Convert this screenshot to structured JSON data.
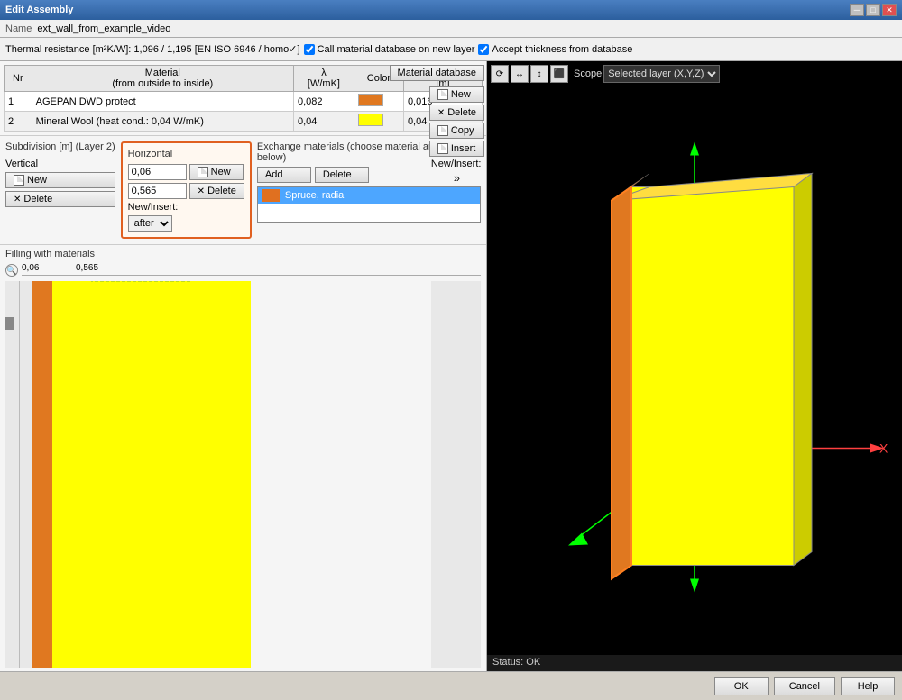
{
  "window": {
    "title": "Edit Assembly",
    "min_label": "─",
    "max_label": "□",
    "close_label": "✕"
  },
  "name_bar": {
    "label": "Name",
    "value": "ext_wall_from_example_video"
  },
  "toolbar": {
    "thermal_resistance": "Thermal resistance [m²K/W]: 1,096 / 1,195 [EN ISO 6946 / homo",
    "checkbox1_label": "Call material database on new layer",
    "checkbox2_label": "Accept thickness from database",
    "checkbox1_checked": true,
    "checkbox2_checked": true
  },
  "materials_table": {
    "headers": [
      "Nr",
      "Material\n(from outside to inside)",
      "λ\n[W/mK]",
      "Color",
      "Thickness\n[m]"
    ],
    "rows": [
      {
        "nr": "1",
        "material": "AGEPAN DWD protect",
        "lambda": "0,082",
        "color": "#e07820",
        "thickness": "0,016"
      },
      {
        "nr": "2",
        "material": "Mineral Wool (heat cond.: 0,04 W/mK)",
        "lambda": "0,04",
        "color": "#ffff00",
        "thickness": "0,04"
      }
    ]
  },
  "action_buttons": {
    "new": "New",
    "delete": "Delete",
    "copy": "Copy",
    "insert": "Insert",
    "new_insert": "New/Insert:",
    "arrow": "»"
  },
  "material_database_btn": "Material database",
  "subdivision": {
    "title": "Subdivision [m] (Layer 2)",
    "vertical_label": "Vertical",
    "vertical_new": "New",
    "vertical_delete": "Delete",
    "horizontal_label": "Horizontal",
    "horiz_value1": "0,06",
    "horiz_value2": "0,565",
    "horiz_new": "New",
    "horiz_delete": "Delete",
    "horiz_new_insert": "New/Insert:",
    "horiz_after": "after"
  },
  "exchange": {
    "title": "Exchange materials (choose material and fill in below)",
    "add_btn": "Add",
    "delete_btn": "Delete",
    "items": [
      {
        "name": "Spruce, radial",
        "color": "#e07820"
      }
    ]
  },
  "filling": {
    "title": "Filling with materials",
    "scale_values": [
      "0,06",
      "0,565"
    ],
    "magnify_icon": "🔍"
  },
  "viewer": {
    "toolbar_icons": [
      "⟳",
      "↔",
      "↕",
      "⬛"
    ],
    "scope_label": "Scope",
    "scope_value": "Selected layer (X,Y,Z)",
    "status": "Status: OK"
  },
  "bottom_buttons": {
    "ok": "OK",
    "cancel": "Cancel",
    "help": "Help"
  },
  "colors": {
    "orange": "#e07820",
    "yellow": "#ffff00",
    "highlight_blue": "#4da6ff",
    "selection_blue": "#316ac5"
  }
}
